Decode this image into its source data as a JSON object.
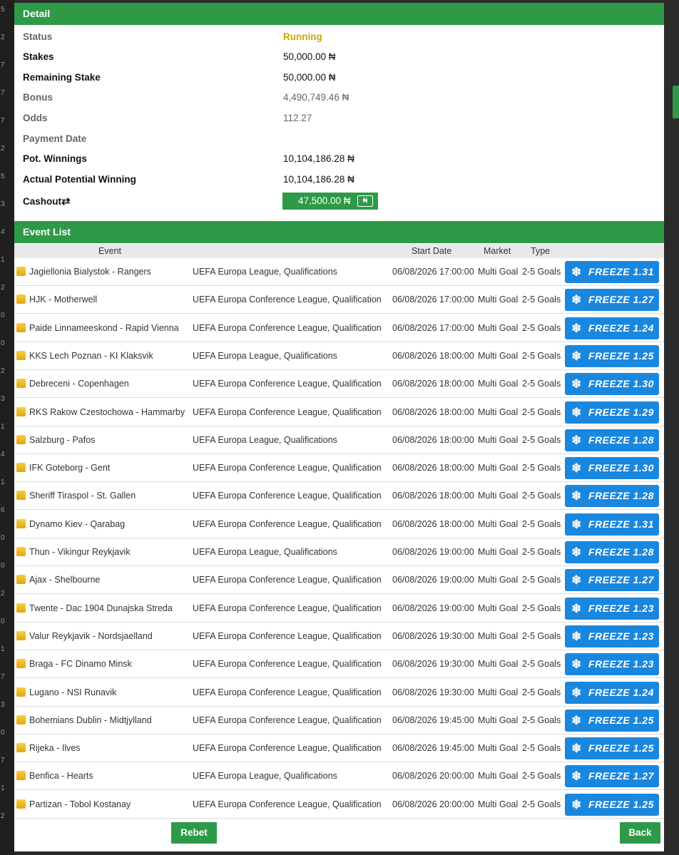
{
  "gutter_digits": [
    "5",
    "2",
    "7",
    "7",
    "7",
    "2",
    "5",
    "3",
    "4",
    "1",
    "2",
    "0",
    "0",
    "2",
    "3",
    "1",
    "4",
    "1",
    "6",
    "0",
    "0",
    "2",
    "0",
    "1",
    "7",
    "3",
    "0",
    "7",
    "1",
    "2"
  ],
  "detail": {
    "title": "Detail",
    "rows": [
      {
        "label": "Status",
        "value": "Running"
      },
      {
        "label": "Stakes",
        "value": "50,000.00 ₦"
      },
      {
        "label": "Remaining Stake",
        "value": "50,000.00 ₦"
      },
      {
        "label": "Bonus",
        "value": "4,490,749.46 ₦"
      },
      {
        "label": "Odds",
        "value": "112.27"
      },
      {
        "label": "Payment Date",
        "value": ""
      },
      {
        "label": "Pot. Winnings",
        "value": "10,104,186.28 ₦"
      },
      {
        "label": "Actual Potential Winning",
        "value": "10,104,186.28 ₦"
      }
    ],
    "cashout_label": "Cashout",
    "cashout_value": "47,500.00 ₦",
    "cashout_icon_glyph": "₦"
  },
  "events": {
    "title": "Event List",
    "headers": {
      "event": "Event",
      "start_date": "Start Date",
      "market": "Market",
      "type": "Type"
    },
    "rows": [
      {
        "event": "Jagiellonia Bialystok - Rangers",
        "competition": "UEFA Europa League, Qualifications",
        "start": "06/08/2026 17:00:00",
        "market": "Multi Goal",
        "type": "2-5 Goals",
        "freeze": "FREEZE 1.31"
      },
      {
        "event": "HJK - Motherwell",
        "competition": "UEFA Europa Conference League, Qualification",
        "start": "06/08/2026 17:00:00",
        "market": "Multi Goal",
        "type": "2-5 Goals",
        "freeze": "FREEZE 1.27"
      },
      {
        "event": "Paide Linnameeskond - Rapid Vienna",
        "competition": "UEFA Europa Conference League, Qualification",
        "start": "06/08/2026 17:00:00",
        "market": "Multi Goal",
        "type": "2-5 Goals",
        "freeze": "FREEZE 1.24"
      },
      {
        "event": "KKS Lech Poznan - KI Klaksvik",
        "competition": "UEFA Europa League, Qualifications",
        "start": "06/08/2026 18:00:00",
        "market": "Multi Goal",
        "type": "2-5 Goals",
        "freeze": "FREEZE 1.25"
      },
      {
        "event": "Debreceni - Copenhagen",
        "competition": "UEFA Europa Conference League, Qualification",
        "start": "06/08/2026 18:00:00",
        "market": "Multi Goal",
        "type": "2-5 Goals",
        "freeze": "FREEZE 1.30"
      },
      {
        "event": "RKS Rakow Czestochowa - Hammarby",
        "competition": "UEFA Europa Conference League, Qualification",
        "start": "06/08/2026 18:00:00",
        "market": "Multi Goal",
        "type": "2-5 Goals",
        "freeze": "FREEZE 1.29"
      },
      {
        "event": "Salzburg - Pafos",
        "competition": "UEFA Europa League, Qualifications",
        "start": "06/08/2026 18:00:00",
        "market": "Multi Goal",
        "type": "2-5 Goals",
        "freeze": "FREEZE 1.28"
      },
      {
        "event": "IFK Goteborg - Gent",
        "competition": "UEFA Europa Conference League, Qualification",
        "start": "06/08/2026 18:00:00",
        "market": "Multi Goal",
        "type": "2-5 Goals",
        "freeze": "FREEZE 1.30"
      },
      {
        "event": "Sheriff Tiraspol - St. Gallen",
        "competition": "UEFA Europa Conference League, Qualification",
        "start": "06/08/2026 18:00:00",
        "market": "Multi Goal",
        "type": "2-5 Goals",
        "freeze": "FREEZE 1.28"
      },
      {
        "event": "Dynamo Kiev - Qarabag",
        "competition": "UEFA Europa Conference League, Qualification",
        "start": "06/08/2026 18:00:00",
        "market": "Multi Goal",
        "type": "2-5 Goals",
        "freeze": "FREEZE 1.31"
      },
      {
        "event": "Thun - Vikingur Reykjavik",
        "competition": "UEFA Europa League, Qualifications",
        "start": "06/08/2026 19:00:00",
        "market": "Multi Goal",
        "type": "2-5 Goals",
        "freeze": "FREEZE 1.28"
      },
      {
        "event": "Ajax - Shelbourne",
        "competition": "UEFA Europa Conference League, Qualification",
        "start": "06/08/2026 19:00:00",
        "market": "Multi Goal",
        "type": "2-5 Goals",
        "freeze": "FREEZE 1.27"
      },
      {
        "event": "Twente - Dac 1904 Dunajska Streda",
        "competition": "UEFA Europa Conference League, Qualification",
        "start": "06/08/2026 19:00:00",
        "market": "Multi Goal",
        "type": "2-5 Goals",
        "freeze": "FREEZE 1.23"
      },
      {
        "event": "Valur Reykjavik - Nordsjaelland",
        "competition": "UEFA Europa Conference League, Qualification",
        "start": "06/08/2026 19:30:00",
        "market": "Multi Goal",
        "type": "2-5 Goals",
        "freeze": "FREEZE 1.23"
      },
      {
        "event": "Braga - FC Dinamo Minsk",
        "competition": "UEFA Europa Conference League, Qualification",
        "start": "06/08/2026 19:30:00",
        "market": "Multi Goal",
        "type": "2-5 Goals",
        "freeze": "FREEZE 1.23"
      },
      {
        "event": "Lugano - NSI Runavik",
        "competition": "UEFA Europa Conference League, Qualification",
        "start": "06/08/2026 19:30:00",
        "market": "Multi Goal",
        "type": "2-5 Goals",
        "freeze": "FREEZE 1.24"
      },
      {
        "event": "Bohemians Dublin - Midtjylland",
        "competition": "UEFA Europa Conference League, Qualification",
        "start": "06/08/2026 19:45:00",
        "market": "Multi Goal",
        "type": "2-5 Goals",
        "freeze": "FREEZE 1.25"
      },
      {
        "event": "Rijeka - Ilves",
        "competition": "UEFA Europa Conference League, Qualification",
        "start": "06/08/2026 19:45:00",
        "market": "Multi Goal",
        "type": "2-5 Goals",
        "freeze": "FREEZE 1.25"
      },
      {
        "event": "Benfica - Hearts",
        "competition": "UEFA Europa League, Qualifications",
        "start": "06/08/2026 20:00:00",
        "market": "Multi Goal",
        "type": "2-5 Goals",
        "freeze": "FREEZE 1.27"
      },
      {
        "event": "Partizan - Tobol Kostanay",
        "competition": "UEFA Europa Conference League, Qualification",
        "start": "06/08/2026 20:00:00",
        "market": "Multi Goal",
        "type": "2-5 Goals",
        "freeze": "FREEZE 1.25"
      }
    ]
  },
  "actions": {
    "rebet": "Rebet",
    "back": "Back"
  },
  "colors": {
    "header_green": "#2e9a48",
    "freeze_blue": "#1a87de",
    "running_yellow": "#c9a800"
  }
}
